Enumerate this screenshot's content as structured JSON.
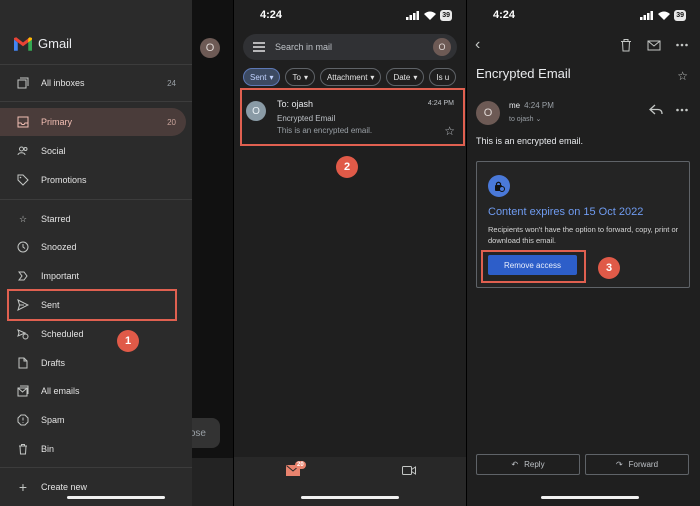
{
  "status": {
    "time": "4:24",
    "battery": "39"
  },
  "drawer": {
    "app_name": "Gmail",
    "items": [
      {
        "label": "All inboxes",
        "count": "24",
        "icon": "all-inboxes-icon"
      },
      {
        "label": "Primary",
        "count": "20",
        "icon": "inbox-icon"
      },
      {
        "label": "Social",
        "count": "",
        "icon": "people-icon"
      },
      {
        "label": "Promotions",
        "count": "",
        "icon": "tag-icon"
      },
      {
        "label": "Starred",
        "count": "",
        "icon": "star-icon"
      },
      {
        "label": "Snoozed",
        "count": "",
        "icon": "clock-icon"
      },
      {
        "label": "Important",
        "count": "",
        "icon": "important-icon"
      },
      {
        "label": "Sent",
        "count": "",
        "icon": "send-icon"
      },
      {
        "label": "Scheduled",
        "count": "",
        "icon": "scheduled-icon"
      },
      {
        "label": "Drafts",
        "count": "",
        "icon": "draft-icon"
      },
      {
        "label": "All emails",
        "count": "",
        "icon": "all-mail-icon"
      },
      {
        "label": "Spam",
        "count": "",
        "icon": "spam-icon"
      },
      {
        "label": "Bin",
        "count": "",
        "icon": "trash-icon"
      },
      {
        "label": "Create new",
        "count": "",
        "icon": "plus-icon"
      }
    ],
    "behind_avatar": "O",
    "behind_compose": "ose"
  },
  "inbox": {
    "search_placeholder": "Search in mail",
    "avatar": "O",
    "chips": [
      "Sent",
      "To",
      "Attachment",
      "Date",
      "Is u"
    ],
    "email": {
      "avatar": "O",
      "to": "To: ojash",
      "time": "4:24 PM",
      "subject": "Encrypted Email",
      "preview": "This is an encrypted email."
    },
    "mail_badge": "20"
  },
  "detail": {
    "subject": "Encrypted Email",
    "sender_avatar": "O",
    "sender": "me",
    "sender_time": "4:24 PM",
    "to_line": "to ojash",
    "body": "This is an encrypted email.",
    "card_title": "Content expires on 15 Oct 2022",
    "card_desc": "Recipients won't have the option to forward, copy, print or download this email.",
    "remove_label": "Remove access",
    "reply_label": "Reply",
    "forward_label": "Forward"
  },
  "steps": [
    "1",
    "2",
    "3"
  ],
  "colors": {
    "highlight": "#e06050",
    "accent_blue": "#6f9bf0",
    "button_blue": "#2d5ec9",
    "active_nav": "#4a3c3a"
  }
}
